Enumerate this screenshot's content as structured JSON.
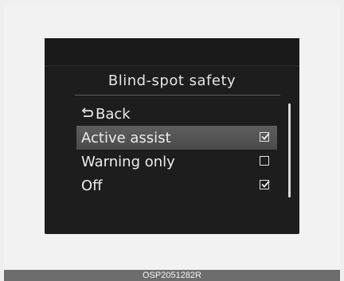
{
  "screen": {
    "title": "Blind-spot safety",
    "menu_items": [
      {
        "label": "Back",
        "icon": "back-arrow-icon",
        "selected": false,
        "checkbox": null
      },
      {
        "label": "Active assist",
        "selected": true,
        "checkbox": "checked"
      },
      {
        "label": "Warning only",
        "selected": false,
        "checkbox": "unchecked"
      },
      {
        "label": "Off",
        "selected": false,
        "checkbox": "checked"
      }
    ]
  },
  "caption": {
    "code": "OSP2051282R"
  },
  "colors": {
    "background": "#efefef",
    "screen": "#1d1d1d",
    "selection": "#555555",
    "text": "#ececec",
    "caption_bar": "#6d6d6d"
  }
}
